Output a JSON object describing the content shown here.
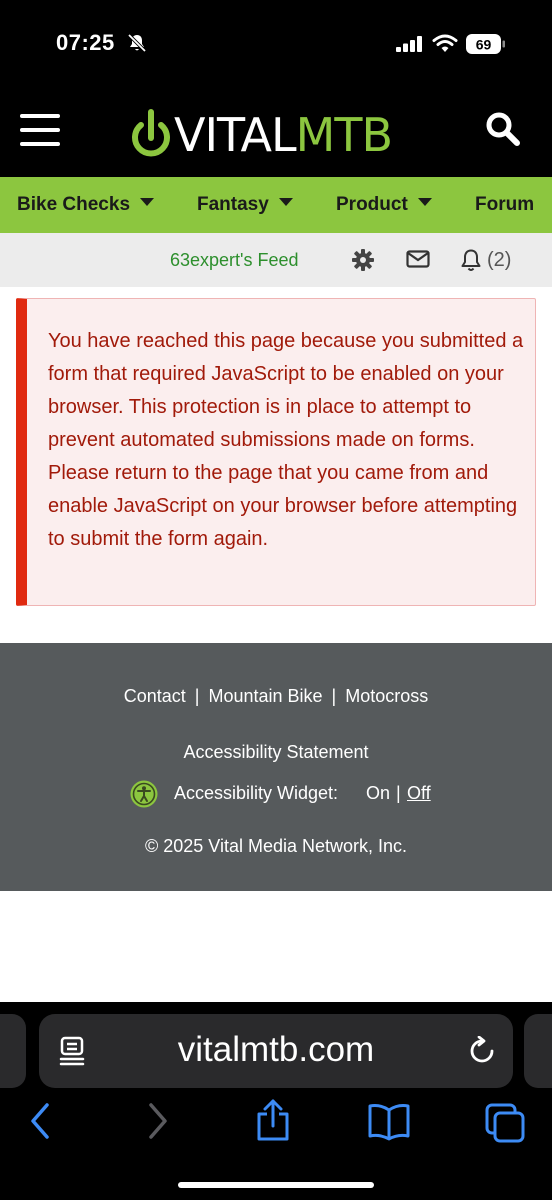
{
  "status_bar": {
    "time": "07:25",
    "battery": "69",
    "icons": [
      "bell-slash-icon",
      "signal-icon",
      "wifi-icon",
      "battery-icon"
    ]
  },
  "header": {
    "logo_part1": "VITAL",
    "logo_part2": "MTB",
    "menu_icon": "hamburger-icon",
    "search_icon": "search-icon"
  },
  "nav": {
    "items": [
      {
        "label": "Bike Checks",
        "dropdown": true
      },
      {
        "label": "Fantasy",
        "dropdown": true
      },
      {
        "label": "Product",
        "dropdown": true
      },
      {
        "label": "Forum",
        "dropdown": false
      }
    ]
  },
  "feed_bar": {
    "feed_label": "63expert's Feed",
    "notifications": "(2)",
    "icons": [
      "gear-icon",
      "mail-icon",
      "bell-icon"
    ]
  },
  "alert": {
    "message": "You have reached this page because you submitted a form that required JavaScript to be enabled on your browser. This protection is in place to attempt to prevent automated submissions made on forms. Please return to the page that you came from and enable JavaScript on your browser before attempting to submit the form again."
  },
  "footer": {
    "links": [
      "Contact",
      "Mountain Bike",
      "Motocross"
    ],
    "separator": "|",
    "accessibility_statement": "Accessibility Statement",
    "widget_label": "Accessibility Widget:",
    "widget_on": "On",
    "widget_pipe": "|",
    "widget_off": "Off",
    "copyright": "© 2025 Vital Media Network, Inc."
  },
  "browser": {
    "url": "vitalmtb.com",
    "icons": [
      "page-menu-icon",
      "reload-icon",
      "back-icon",
      "forward-icon",
      "share-icon",
      "bookmarks-icon",
      "tabs-icon"
    ]
  },
  "colors": {
    "brand_green": "#8cc63f",
    "alert_red": "#e02a10",
    "alert_text": "#a11a0a",
    "feed_green": "#2d8f2d",
    "footer_bg": "#565a5c",
    "ios_blue": "#3d8bf5"
  }
}
